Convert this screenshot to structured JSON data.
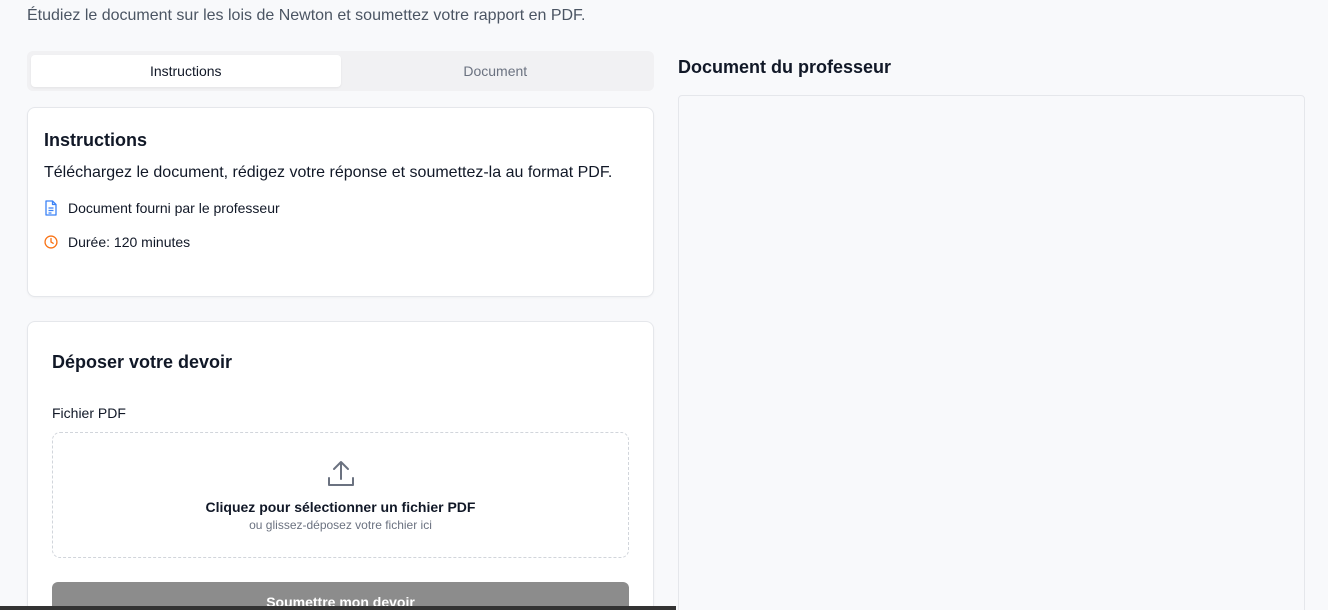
{
  "header": {
    "subtitle": "Étudiez le document sur les lois de Newton et soumettez votre rapport en PDF."
  },
  "tabs": [
    {
      "label": "Instructions",
      "active": true
    },
    {
      "label": "Document",
      "active": false
    }
  ],
  "instructions": {
    "title": "Instructions",
    "text": "Téléchargez le document, rédigez votre réponse et soumettez-la au format PDF.",
    "document_note": "Document fourni par le professeur",
    "duration": "Durée: 120 minutes"
  },
  "upload": {
    "title": "Déposer votre devoir",
    "field_label": "Fichier PDF",
    "dropzone_main": "Cliquez pour sélectionner un fichier PDF",
    "dropzone_sub": "ou glissez-déposez votre fichier ici",
    "submit_label": "Soumettre mon devoir"
  },
  "document_panel": {
    "title": "Document du professeur"
  },
  "colors": {
    "doc_icon": "#3b82f6",
    "clock_icon": "#f97316",
    "submit_disabled": "#8c8c8c"
  },
  "icons": [
    "document-icon",
    "clock-icon",
    "upload-icon"
  ]
}
